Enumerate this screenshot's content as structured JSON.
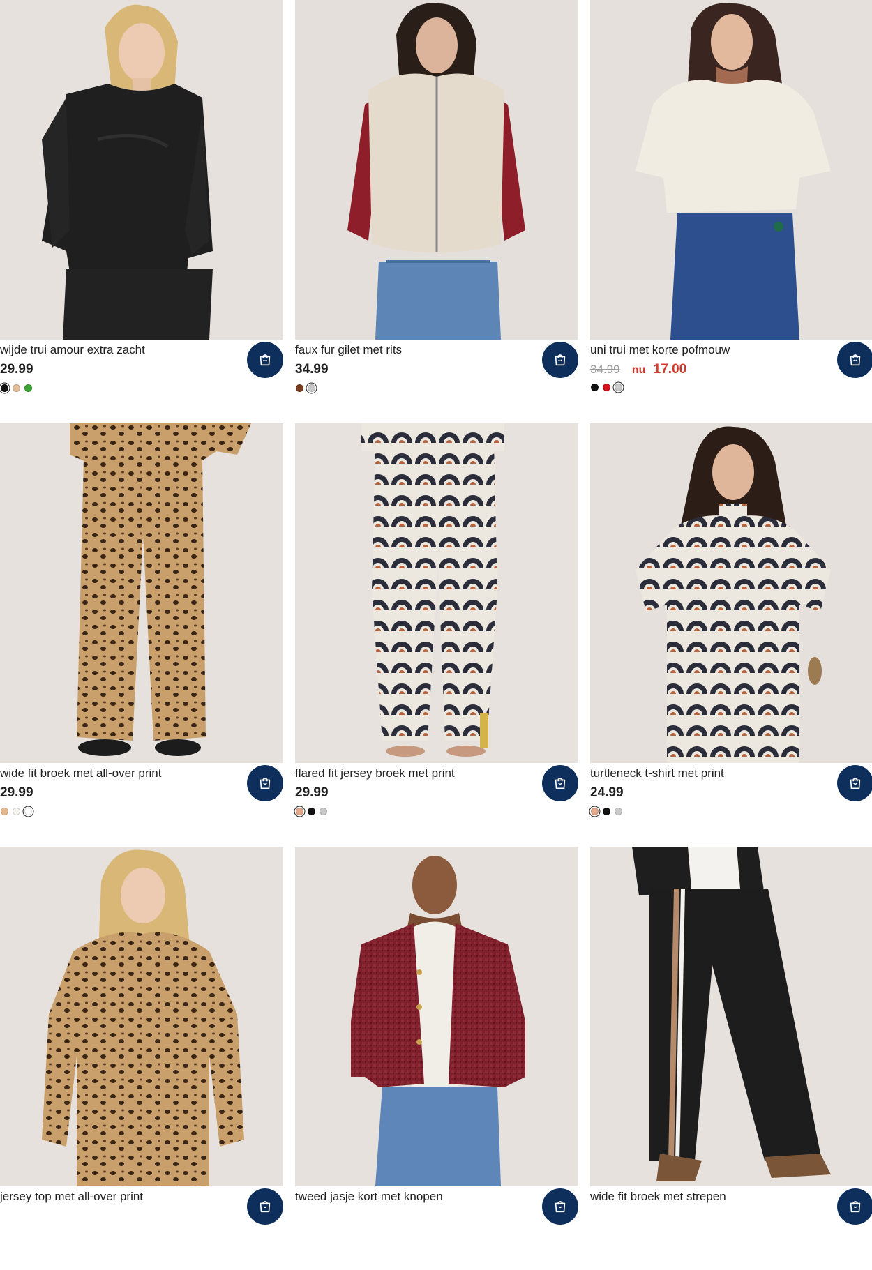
{
  "products": [
    {
      "title": "wijde trui amour extra zacht",
      "price": "29.99",
      "old_price": null,
      "nu_label": null,
      "sale_price": null,
      "cart_icon": "shopping-bag-icon",
      "swatches": [
        {
          "color": "#111111",
          "selected": true
        },
        {
          "color": "#e2bf9a",
          "selected": false
        },
        {
          "color": "#3aa232",
          "selected": false
        }
      ]
    },
    {
      "title": "faux fur gilet met rits",
      "price": "34.99",
      "old_price": null,
      "nu_label": null,
      "sale_price": null,
      "cart_icon": "shopping-bag-icon",
      "swatches": [
        {
          "color": "#7a3d1d",
          "selected": false
        },
        {
          "color": "#c9c9c9",
          "selected": true
        }
      ]
    },
    {
      "title": "uni trui met korte pofmouw",
      "price": null,
      "old_price": "34.99",
      "nu_label": "nu",
      "sale_price": "17.00",
      "cart_icon": "shopping-bag-icon",
      "swatches": [
        {
          "color": "#111111",
          "selected": false
        },
        {
          "color": "#d4121b",
          "selected": false
        },
        {
          "color": "#c9c9c9",
          "selected": true
        }
      ]
    },
    {
      "title": "wide fit broek met all-over print",
      "price": "29.99",
      "old_price": null,
      "nu_label": null,
      "sale_price": null,
      "cart_icon": "shopping-bag-icon",
      "swatches": [
        {
          "color": "#e4b88f",
          "selected": false
        },
        {
          "color": "#f6f4ef",
          "selected": false
        },
        {
          "color": "#ffffff",
          "selected": true
        }
      ]
    },
    {
      "title": "flared fit jersey broek met print",
      "price": "29.99",
      "old_price": null,
      "nu_label": null,
      "sale_price": null,
      "cart_icon": "shopping-bag-icon",
      "swatches": [
        {
          "color": "#e4a88a",
          "selected": true
        },
        {
          "color": "#111111",
          "selected": false
        },
        {
          "color": "#c9c9c9",
          "selected": false
        }
      ]
    },
    {
      "title": "turtleneck t-shirt met print",
      "price": "24.99",
      "old_price": null,
      "nu_label": null,
      "sale_price": null,
      "cart_icon": "shopping-bag-icon",
      "swatches": [
        {
          "color": "#e4a88a",
          "selected": true
        },
        {
          "color": "#111111",
          "selected": false
        },
        {
          "color": "#c9c9c9",
          "selected": false
        }
      ]
    },
    {
      "title": "jersey top met all-over print",
      "price": null,
      "old_price": null,
      "nu_label": null,
      "sale_price": null,
      "cart_icon": "shopping-bag-icon",
      "swatches": []
    },
    {
      "title": "tweed jasje kort met knopen",
      "price": null,
      "old_price": null,
      "nu_label": null,
      "sale_price": null,
      "cart_icon": "shopping-bag-icon",
      "swatches": []
    },
    {
      "title": "wide fit broek met strepen",
      "price": null,
      "old_price": null,
      "nu_label": null,
      "sale_price": null,
      "cart_icon": "shopping-bag-icon",
      "swatches": []
    }
  ],
  "colors": {
    "cart_button": "#0e2f5c",
    "sale": "#d5372a",
    "photo_background": "#e7e2dd"
  }
}
